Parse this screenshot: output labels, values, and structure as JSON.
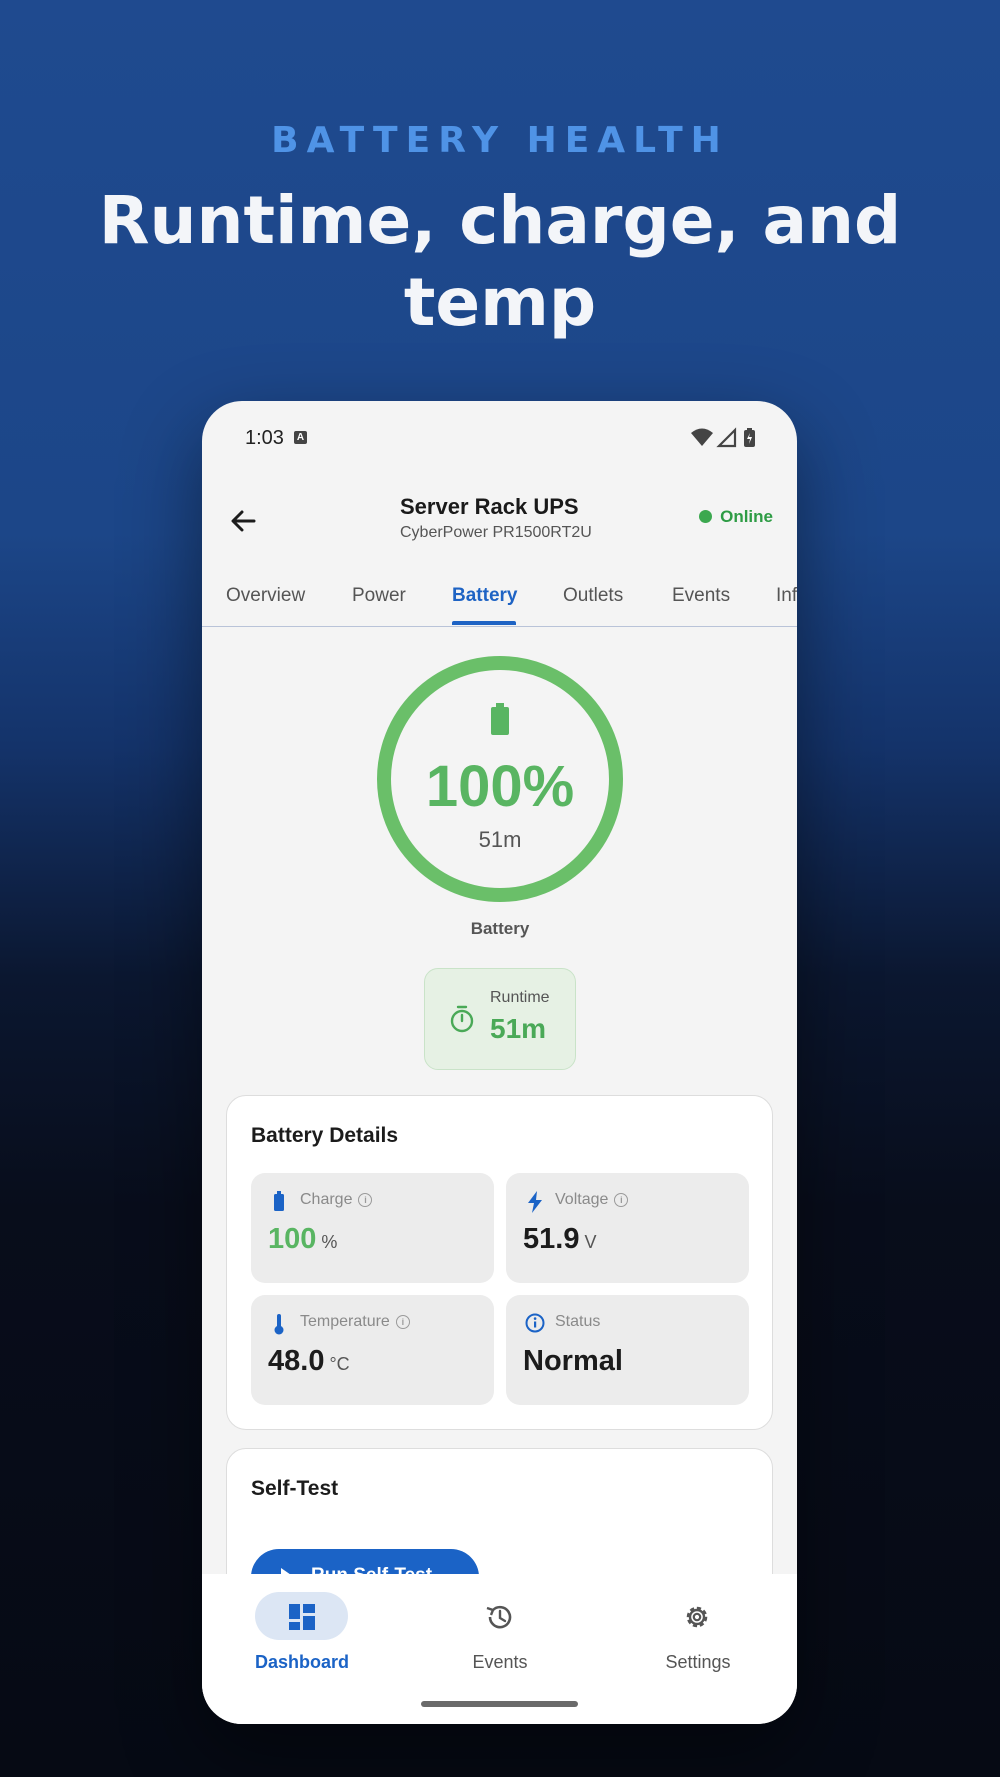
{
  "hero": {
    "kicker": "BATTERY HEALTH",
    "title": "Runtime, charge, and temp"
  },
  "status_bar": {
    "time": "1:03",
    "notification_icon": "a-icon",
    "icons": [
      "wifi-icon",
      "signal-icon",
      "battery-charging-icon"
    ]
  },
  "app_bar": {
    "title": "Server Rack UPS",
    "subtitle": "CyberPower PR1500RT2U",
    "status": "Online",
    "status_color": "#3ba84f"
  },
  "tabs": [
    {
      "label": "Overview"
    },
    {
      "label": "Power"
    },
    {
      "label": "Battery",
      "active": true
    },
    {
      "label": "Outlets"
    },
    {
      "label": "Events"
    },
    {
      "label": "Inf"
    }
  ],
  "gauge": {
    "percent_label": "100%",
    "percent_value": 100,
    "runtime": "51m",
    "label": "Battery",
    "color": "#6abf69"
  },
  "runtime_chip": {
    "label": "Runtime",
    "value": "51m"
  },
  "battery_details": {
    "title": "Battery Details",
    "tiles": [
      {
        "label": "Charge",
        "value": "100",
        "unit": "%",
        "icon": "battery-icon",
        "value_color": "#59b562"
      },
      {
        "label": "Voltage",
        "value": "51.9",
        "unit": "V",
        "icon": "bolt-icon",
        "value_color": "#1c1c1c"
      },
      {
        "label": "Temperature",
        "value": "48.0",
        "unit": "°C",
        "icon": "thermometer-icon",
        "value_color": "#1c1c1c"
      },
      {
        "label": "Status",
        "value": "Normal",
        "unit": "",
        "icon": "info-icon",
        "value_color": "#1c1c1c"
      }
    ]
  },
  "self_test": {
    "title": "Self-Test",
    "button_label": "Run Self-Test"
  },
  "nav": [
    {
      "label": "Dashboard",
      "icon": "dashboard-icon",
      "active": true
    },
    {
      "label": "Events",
      "icon": "history-icon",
      "active": false
    },
    {
      "label": "Settings",
      "icon": "gear-icon",
      "active": false
    }
  ],
  "accent_color": "#1b63c6"
}
